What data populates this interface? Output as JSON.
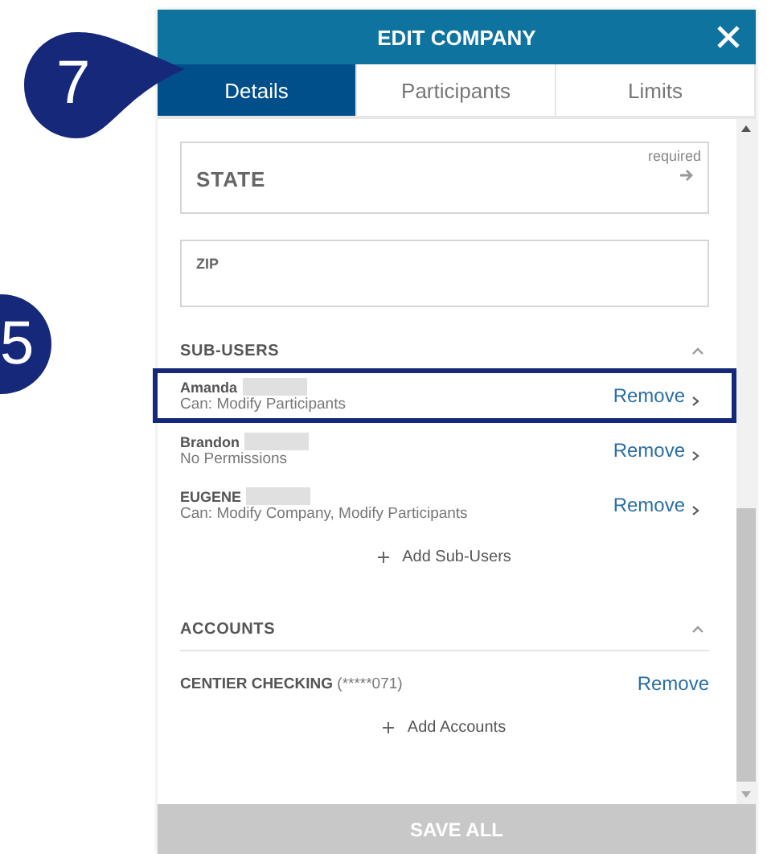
{
  "callouts": [
    {
      "number": "7",
      "kind": "pointer"
    },
    {
      "number": "5",
      "kind": "circle"
    }
  ],
  "dialog": {
    "title": "EDIT COMPANY"
  },
  "tabs": [
    {
      "label": "Details",
      "selected": true
    },
    {
      "label": "Participants",
      "selected": false
    },
    {
      "label": "Limits",
      "selected": false
    }
  ],
  "fields": [
    {
      "label": "STATE",
      "hint": "required",
      "kind": "select"
    },
    {
      "label": "ZIP",
      "kind": "text"
    }
  ],
  "sections": [
    {
      "title": "SUB-USERS",
      "expanded": true,
      "add_label": "Add Sub-Users",
      "items": [
        {
          "kind": "user",
          "name": "Amanda",
          "detail": "Can: Modify Participants",
          "action": "Remove",
          "highlighted": true
        },
        {
          "kind": "user",
          "name": "Brandon",
          "detail": "No Permissions",
          "action": "Remove",
          "highlighted": false
        },
        {
          "kind": "user",
          "name": "EUGENE",
          "detail": "Can: Modify Company, Modify Participants",
          "action": "Remove",
          "highlighted": false
        }
      ]
    },
    {
      "title": "ACCOUNTS",
      "expanded": true,
      "add_label": "Add Accounts",
      "items": [
        {
          "kind": "account",
          "name": "CENTIER CHECKING",
          "number": "(*****071)",
          "action": "Remove"
        }
      ]
    }
  ],
  "save_button": "SAVE ALL"
}
